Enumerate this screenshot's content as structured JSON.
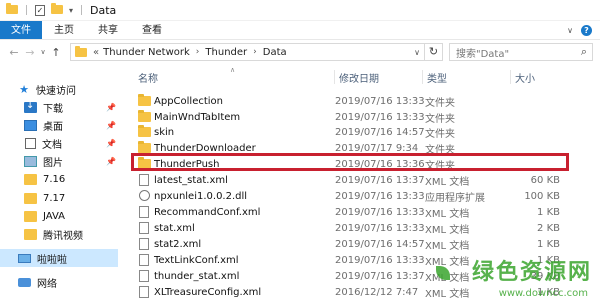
{
  "window": {
    "title": "Data"
  },
  "ribbon": {
    "tabs": [
      "文件",
      "主页",
      "共享",
      "查看"
    ]
  },
  "address": {
    "prefix": "«",
    "crumbs": [
      "Thunder Network",
      "Thunder",
      "Data"
    ]
  },
  "search": {
    "placeholder": "搜索\"Data\""
  },
  "nav": {
    "items": [
      {
        "label": "快速访问",
        "icon": "star-icon"
      },
      {
        "label": "下载",
        "icon": "download-folder-icon",
        "pinned": true
      },
      {
        "label": "桌面",
        "icon": "desktop-icon",
        "pinned": true
      },
      {
        "label": "文档",
        "icon": "documents-icon",
        "pinned": true
      },
      {
        "label": "图片",
        "icon": "pictures-icon",
        "pinned": true
      },
      {
        "label": "7.16",
        "icon": "folder-icon"
      },
      {
        "label": "7.17",
        "icon": "folder-icon"
      },
      {
        "label": "JAVA",
        "icon": "folder-icon"
      },
      {
        "label": "腾讯视频",
        "icon": "folder-icon"
      },
      {
        "label": "啦啦啦",
        "icon": "this-pc-icon"
      },
      {
        "label": "网络",
        "icon": "network-icon"
      }
    ]
  },
  "columns": {
    "name": "名称",
    "date": "修改日期",
    "type": "类型",
    "size": "大小"
  },
  "files": [
    {
      "name": "AppCollection",
      "date": "2019/07/16 13:33",
      "type": "文件夹",
      "size": "",
      "kind": "folder"
    },
    {
      "name": "MainWndTabItem",
      "date": "2019/07/16 13:33",
      "type": "文件夹",
      "size": "",
      "kind": "folder"
    },
    {
      "name": "skin",
      "date": "2019/07/16 14:57",
      "type": "文件夹",
      "size": "",
      "kind": "folder"
    },
    {
      "name": "ThunderDownloader",
      "date": "2019/07/17 9:34",
      "type": "文件夹",
      "size": "",
      "kind": "folder"
    },
    {
      "name": "ThunderPush",
      "date": "2019/07/16 13:36",
      "type": "文件夹",
      "size": "",
      "kind": "folder"
    },
    {
      "name": "latest_stat.xml",
      "date": "2019/07/16 13:37",
      "type": "XML 文档",
      "size": "60 KB",
      "kind": "file"
    },
    {
      "name": "npxunlei1.0.0.2.dll",
      "date": "2019/07/16 13:33",
      "type": "应用程序扩展",
      "size": "100 KB",
      "kind": "dll"
    },
    {
      "name": "RecommandConf.xml",
      "date": "2019/07/16 13:33",
      "type": "XML 文档",
      "size": "1 KB",
      "kind": "file"
    },
    {
      "name": "stat.xml",
      "date": "2019/07/16 13:33",
      "type": "XML 文档",
      "size": "2 KB",
      "kind": "file"
    },
    {
      "name": "stat2.xml",
      "date": "2019/07/16 14:57",
      "type": "XML 文档",
      "size": "1 KB",
      "kind": "file"
    },
    {
      "name": "TextLinkConf.xml",
      "date": "2019/07/16 13:33",
      "type": "XML 文档",
      "size": "1 KB",
      "kind": "file"
    },
    {
      "name": "thunder_stat.xml",
      "date": "2019/07/16 13:37",
      "type": "XML 文档",
      "size": "39 KB",
      "kind": "file"
    },
    {
      "name": "XLTreasureConfig.xml",
      "date": "2016/12/12 7:47",
      "type": "XML 文档",
      "size": "1 KB",
      "kind": "file"
    }
  ],
  "highlight_row": "ThunderPush",
  "watermark": {
    "text": "绿色资源网",
    "url": "www.downcc.com",
    "color": "#3aa52d"
  },
  "colors": {
    "accent": "#1979ca",
    "highlight_border": "#c8202f",
    "folder": "#f6c344"
  }
}
